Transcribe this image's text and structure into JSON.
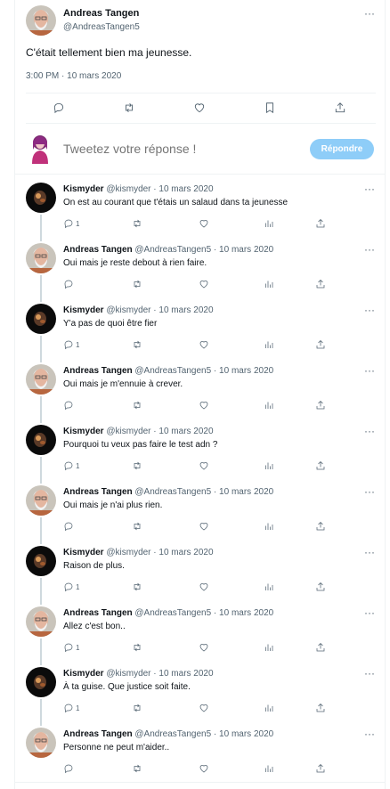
{
  "main_tweet": {
    "author_name": "Andreas Tangen",
    "author_handle": "@AndreasTangen5",
    "text": "C'était tellement bien ma jeunesse.",
    "timestamp": "3:00 PM · 10 mars 2020",
    "more_label": "···"
  },
  "compose": {
    "placeholder": "Tweetez votre réponse !",
    "reply_button": "Répondre"
  },
  "replies": [
    {
      "name": "Kismyder",
      "meta": "@kismyder · 10 mars 2020",
      "text": "On est au courant que t'étais un salaud dans ta jeunesse",
      "reply_count": "1",
      "avatar": "dark"
    },
    {
      "name": "Andreas Tangen",
      "meta": "@AndreasTangen5 · 10 mars 2020",
      "text": "Oui mais je reste debout à rien faire.",
      "reply_count": "",
      "avatar": "man"
    },
    {
      "name": "Kismyder",
      "meta": "@kismyder · 10 mars 2020",
      "text": "Y'a pas de quoi être fier",
      "reply_count": "1",
      "avatar": "dark"
    },
    {
      "name": "Andreas Tangen",
      "meta": "@AndreasTangen5 · 10 mars 2020",
      "text": "Oui mais je m'ennuie à crever.",
      "reply_count": "",
      "avatar": "man"
    },
    {
      "name": "Kismyder",
      "meta": "@kismyder · 10 mars 2020",
      "text": "Pourquoi tu veux pas faire le test adn ?",
      "reply_count": "1",
      "avatar": "dark"
    },
    {
      "name": "Andreas Tangen",
      "meta": "@AndreasTangen5 · 10 mars 2020",
      "text": "Oui mais je n'ai plus rien.",
      "reply_count": "",
      "avatar": "man"
    },
    {
      "name": "Kismyder",
      "meta": "@kismyder · 10 mars 2020",
      "text": "Raison de plus.",
      "reply_count": "1",
      "avatar": "dark"
    },
    {
      "name": "Andreas Tangen",
      "meta": "@AndreasTangen5 · 10 mars 2020",
      "text": "Allez c'est bon..",
      "reply_count": "1",
      "avatar": "man"
    },
    {
      "name": "Kismyder",
      "meta": "@kismyder · 10 mars 2020",
      "text": "À ta guise. Que justice soit faite.",
      "reply_count": "1",
      "avatar": "dark"
    },
    {
      "name": "Andreas Tangen",
      "meta": "@AndreasTangen5 · 10 mars 2020",
      "text": "Personne ne peut m'aider..",
      "reply_count": "",
      "avatar": "man"
    }
  ],
  "icons": {
    "reply": "reply-icon",
    "retweet": "retweet-icon",
    "like": "heart-icon",
    "views": "views-icon",
    "bookmark": "bookmark-icon",
    "share": "share-icon"
  },
  "colors": {
    "accent_light": "#8ecdf8",
    "secondary_text": "#536471",
    "divider": "#eff3f4"
  }
}
